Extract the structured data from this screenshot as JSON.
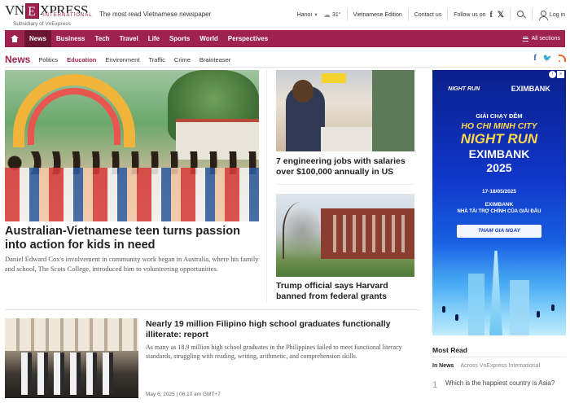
{
  "header": {
    "logo_vn": "VN",
    "logo_e": "E",
    "logo_xpress": "XPRESS",
    "logo_intl": "INTERNATIONAL",
    "logo_sub": "Subsidiary of VnExpress",
    "tagline": "The most read Vietnamese newspaper",
    "location": "Hanoi",
    "temperature": "31°",
    "edition_link": "Vietnamese Edition",
    "contact_link": "Contact us",
    "follow_label": "Follow us on",
    "social_facebook": "f",
    "social_x": "𝕏",
    "login_label": "Log in"
  },
  "nav": {
    "items": [
      {
        "label": "News",
        "active": true
      },
      {
        "label": "Business"
      },
      {
        "label": "Tech"
      },
      {
        "label": "Travel"
      },
      {
        "label": "Life"
      },
      {
        "label": "Sports"
      },
      {
        "label": "World"
      },
      {
        "label": "Perspectives"
      }
    ],
    "all_sections": "All sections"
  },
  "section": {
    "title": "News",
    "subnav": [
      "Politics",
      "Education",
      "Environment",
      "Traffic",
      "Crime",
      "Brainteaser"
    ],
    "active_sub": "Education",
    "social_fb": "f",
    "social_tw": "🐦"
  },
  "articles": {
    "main": {
      "title": "Australian-Vietnamese teen turns passion into action for kids in need",
      "desc": "Daniel Edward Cox's involvement in community work began in Australia, where his family and school, The Scots College, introduced him to volunteering opportunities."
    },
    "engineering": {
      "title": "7 engineering jobs with salaries over $100,000 annually in US"
    },
    "harvard": {
      "title": "Trump official says Harvard banned from federal grants"
    },
    "filipino": {
      "title": "Nearly 19 million Filipino high school graduates functionally illiterate: report",
      "desc": "As many as 18.9 million high school graduates in the Philippines failed to meet functional literacy standards, struggling with reading, writing, arithmetic, and comprehension skills.",
      "timestamp": "May 6, 2025 | 06:10 am GMT+7"
    }
  },
  "ad": {
    "brand_run": "NIGHT RUN",
    "brand_bank": "EXIMBANK",
    "line1": "GIẢI CHẠY ĐÊM",
    "line2": "HO CHI MINH CITY",
    "line3": "NIGHT RUN",
    "line4": "EXIMBANK",
    "line5": "2025",
    "date": "17-18/05/2025",
    "sponsor1": "EXIMBANK",
    "sponsor2": "NHÀ TÀI TRỢ CHÍNH CỦA GIẢI ĐẤU",
    "cta": "THAM GIA NGAY",
    "close_glyph": "×",
    "info_glyph": "i"
  },
  "most_read": {
    "title": "Most Read",
    "tabs": [
      {
        "label": "In News",
        "active": true
      },
      {
        "label": "Across VnExpress International"
      }
    ],
    "items": [
      {
        "num": "1",
        "text": "Which is the happiest country is Asia?"
      }
    ]
  },
  "colors": {
    "brand": "#9f224e",
    "nav_active": "#6a1532",
    "facebook": "#3b5998",
    "twitter": "#1da1f2",
    "rss": "#f26522"
  },
  "icons": {
    "home": "home-icon",
    "weather": "weather-icon",
    "search": "search-icon",
    "user": "user-icon",
    "menu": "menu-icon",
    "rss": "rss-icon"
  }
}
